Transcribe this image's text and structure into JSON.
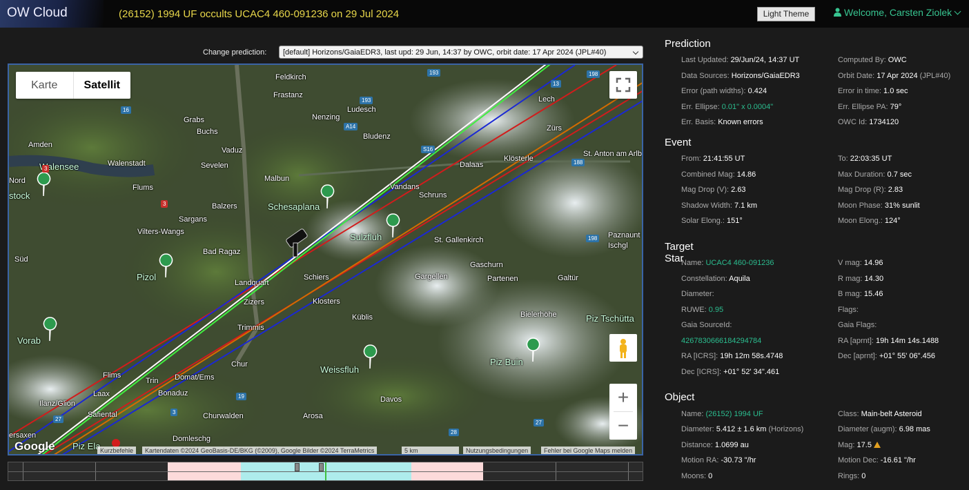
{
  "header": {
    "app_name": "OW Cloud",
    "title": "(26152) 1994 UF occults UCAC4 460-091236 on 29 Jul 2024",
    "theme_button": "Light Theme",
    "welcome": "Welcome, Carsten Ziolek"
  },
  "prediction_select": {
    "label": "Change prediction:",
    "selected": "[default] Horizons/GaiaEDR3, last upd: 29 Jun, 14:37 by OWC, orbit date: 17 Apr 2024 (JPL#40)"
  },
  "map": {
    "type_karte": "Karte",
    "type_satellit": "Satellit",
    "google_logo": "Google",
    "attribution": {
      "shortcuts": "Kurzbefehle",
      "data": "Kartendaten ©2024 GeoBasis-DE/BKG (©2009), Google Bilder ©2024 TerraMetrics",
      "scale": "5 km",
      "terms": "Nutzungsbedingungen",
      "report": "Fehler bei Google Maps melden"
    },
    "places": [
      "Feldkirch",
      "Frastanz",
      "Ludesch",
      "Nenzing",
      "Grabs",
      "Buchs",
      "Bludenz",
      "Lech",
      "Zürs",
      "Amden",
      "Walensee",
      "Walenstadt",
      "Vaduz",
      "Sevelen",
      "St. Anton am Arlberg",
      "Klösterle",
      "Dalaas",
      "Nord",
      "Flums",
      "Malbun",
      "Vandans",
      "stock",
      "Balzers",
      "Schesaplana",
      "Schruns",
      "Sargans",
      "Vilters-Wangs",
      "Paznaunt",
      "Ischgl",
      "Sulzfluh",
      "St. Gallenkirch",
      "Bad Ragaz",
      "Gaschurn",
      "Süd",
      "Pizol",
      "Landquart",
      "Schiers",
      "Gargellen",
      "Partenen",
      "Galtür",
      "Zizers",
      "Klosters",
      "Küblis",
      "Bielerhöhe",
      "Piz Tschütta",
      "Trimmis",
      "Vorab",
      "Piz Buin",
      "Weissfluh",
      "Chur",
      "Flims",
      "Domat/Ems",
      "Trin",
      "Laax",
      "Bonaduz",
      "Davos",
      "Ilanz/Glion",
      "Safiental",
      "Churwalden",
      "Arosa",
      "ersaxen",
      "Domleschg",
      "Piz Ela"
    ],
    "roads": [
      "193",
      "16",
      "193",
      "A14",
      "3",
      "3",
      "S16",
      "188",
      "198",
      "198",
      "13",
      "3",
      "19",
      "27",
      "27",
      "28"
    ]
  },
  "panel": {
    "prediction": {
      "heading": "Prediction",
      "last_updated_label": "Last Updated:",
      "last_updated": "29/Jun/24, 14:37 UT",
      "computed_by_label": "Computed By:",
      "computed_by": "OWC",
      "data_sources_label": "Data Sources:",
      "data_sources": "Horizons/GaiaEDR3",
      "orbit_date_label": "Orbit Date:",
      "orbit_date": "17 Apr 2024",
      "orbit_jpl": "(JPL#40)",
      "error_path_label": "Error (path widths):",
      "error_path": "0.424",
      "error_time_label": "Error in time:",
      "error_time": "1.0 sec",
      "ellipse_label": "Err. Ellipse:",
      "ellipse": "0.01\" x 0.0004\"",
      "ellipse_pa_label": "Err. Ellipse PA:",
      "ellipse_pa": "79°",
      "basis_label": "Err. Basis:",
      "basis": "Known errors",
      "owc_id_label": "OWC Id:",
      "owc_id": "1734120"
    },
    "event": {
      "heading": "Event",
      "from_label": "From:",
      "from": "21:41:55 UT",
      "to_label": "To:",
      "to": "22:03:35 UT",
      "comb_mag_label": "Combined Mag:",
      "comb_mag": "14.86",
      "max_dur_label": "Max Duration:",
      "max_dur": "0.7 sec",
      "drop_v_label": "Mag Drop (V):",
      "drop_v": "2.63",
      "drop_r_label": "Mag Drop (R):",
      "drop_r": "2.83",
      "shadow_label": "Shadow Width:",
      "shadow": "7.1 km",
      "moon_phase_label": "Moon Phase:",
      "moon_phase": "31% sunlit",
      "solar_elong_label": "Solar Elong.:",
      "solar_elong": "151°",
      "moon_elong_label": "Moon Elong.:",
      "moon_elong": "124°"
    },
    "target": {
      "heading": "Target Star",
      "name_label": "Name:",
      "name": "UCAC4 460-091236",
      "vmag_label": "V mag:",
      "vmag": "14.96",
      "const_label": "Constellation:",
      "const": "Aquila",
      "rmag_label": "R mag:",
      "rmag": "14.30",
      "diam_label": "Diameter:",
      "bmag_label": "B mag:",
      "bmag": "15.46",
      "ruwe_label": "RUWE:",
      "ruwe": "0.95",
      "flags_label": "Flags:",
      "gaia_label": "Gaia SourceId:",
      "gaia_flags_label": "Gaia Flags:",
      "gaia_id": "4267830666184294784",
      "ra_aprnt_label": "RA [aprnt]:",
      "ra_aprnt": "19h 14m 14s.1488",
      "ra_icrs_label": "RA [ICRS]:",
      "ra_icrs": "19h 12m 58s.4748",
      "dec_aprnt_label": "Dec [aprnt]:",
      "dec_aprnt": "+01° 55' 06\".456",
      "dec_icrs_label": "Dec [ICRS]:",
      "dec_icrs": "+01° 52' 34\".461"
    },
    "object": {
      "heading": "Object",
      "name_label": "Name:",
      "name": "(26152) 1994 UF",
      "class_label": "Class:",
      "class": "Main-belt Asteroid",
      "diam_label": "Diameter:",
      "diam": "5.412 ± 1.6 km",
      "diam_src": "(Horizons)",
      "diam_augm_label": "Diameter (augm):",
      "diam_augm": "6.98 mas",
      "dist_label": "Distance:",
      "dist": "1.0699 au",
      "mag_label": "Mag:",
      "mag": "17.5",
      "mra_label": "Motion RA:",
      "mra": "-30.73 \"/hr",
      "mdec_label": "Motion Dec:",
      "mdec": "-16.61 \"/hr",
      "moons_label": "Moons:",
      "moons": "0",
      "rings_label": "Rings:",
      "rings": "0"
    }
  }
}
